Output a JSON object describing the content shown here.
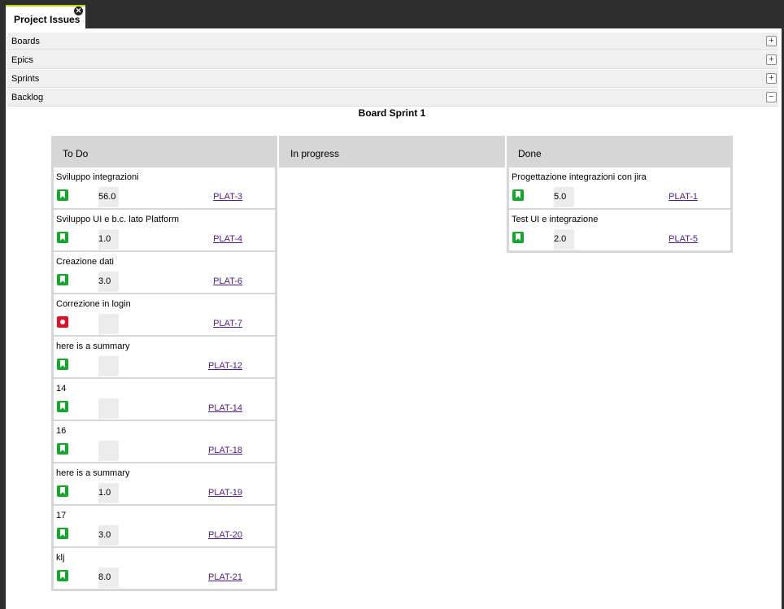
{
  "tab": {
    "title": "Project Issues",
    "close": "✕"
  },
  "accordion": [
    {
      "label": "Boards",
      "toggle": "+"
    },
    {
      "label": "Epics",
      "toggle": "+"
    },
    {
      "label": "Sprints",
      "toggle": "+"
    },
    {
      "label": "Backlog",
      "toggle": "−"
    }
  ],
  "board": {
    "title": "Board Sprint 1",
    "columns": [
      {
        "name": "To Do",
        "cards": [
          {
            "summary": "Sviluppo integrazioni",
            "type": "story",
            "estimate": "56.0",
            "key": "PLAT-3"
          },
          {
            "summary": "Sviluppo UI e b.c. lato Platform",
            "type": "story",
            "estimate": "1.0",
            "key": "PLAT-4"
          },
          {
            "summary": "Creazione dati",
            "type": "story",
            "estimate": "3.0",
            "key": "PLAT-6"
          },
          {
            "summary": "Correzione in login",
            "type": "bug",
            "estimate": "",
            "key": "PLAT-7"
          },
          {
            "summary": "here is a summary",
            "type": "story",
            "estimate": "",
            "key": "PLAT-12"
          },
          {
            "summary": "14",
            "type": "story",
            "estimate": "",
            "key": "PLAT-14"
          },
          {
            "summary": "16",
            "type": "story",
            "estimate": "",
            "key": "PLAT-18"
          },
          {
            "summary": "here is a summary",
            "type": "story",
            "estimate": "1.0",
            "key": "PLAT-19"
          },
          {
            "summary": "17",
            "type": "story",
            "estimate": "3.0",
            "key": "PLAT-20"
          },
          {
            "summary": "klj",
            "type": "story",
            "estimate": "8.0",
            "key": "PLAT-21"
          }
        ]
      },
      {
        "name": "In progress",
        "cards": []
      },
      {
        "name": "Done",
        "cards": [
          {
            "summary": "Progettazione integrazioni con jira",
            "type": "story",
            "estimate": "5.0",
            "key": "PLAT-1"
          },
          {
            "summary": "Test UI e integrazione",
            "type": "story",
            "estimate": "2.0",
            "key": "PLAT-5"
          }
        ]
      }
    ]
  },
  "colors": {
    "tab_accent": "#c8d400",
    "story": "#14a72c",
    "bug": "#e0102a",
    "link": "#551a8b"
  }
}
